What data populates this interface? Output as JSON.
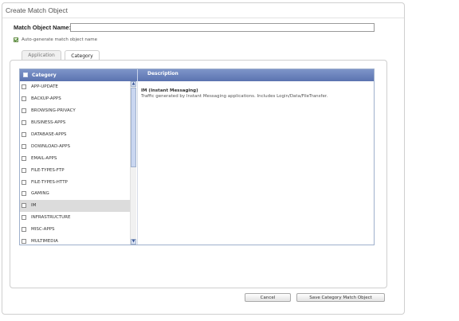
{
  "dialog": {
    "title": "Create Match Object",
    "match_object_name_label": "Match Object Name:",
    "match_object_name_value": "",
    "auto_generate_label": "Auto-generate match object name",
    "auto_generate_checked": true
  },
  "tabs": [
    {
      "label": "Application",
      "active": false
    },
    {
      "label": "Category",
      "active": true
    }
  ],
  "grid": {
    "headers": {
      "category": "Category",
      "description": "Description"
    },
    "categories": [
      {
        "name": "APP-UPDATE",
        "selected": false
      },
      {
        "name": "BACKUP-APPS",
        "selected": false
      },
      {
        "name": "BROWSING-PRIVACY",
        "selected": false
      },
      {
        "name": "BUSINESS-APPS",
        "selected": false
      },
      {
        "name": "DATABASE-APPS",
        "selected": false
      },
      {
        "name": "DOWNLOAD-APPS",
        "selected": false
      },
      {
        "name": "EMAIL-APPS",
        "selected": false
      },
      {
        "name": "FILE-TYPES-FTP",
        "selected": false
      },
      {
        "name": "FILE-TYPES-HTTP",
        "selected": false
      },
      {
        "name": "GAMING",
        "selected": false
      },
      {
        "name": "IM",
        "selected": true
      },
      {
        "name": "INFRASTRUCTURE",
        "selected": false
      },
      {
        "name": "MISC-APPS",
        "selected": false
      },
      {
        "name": "MULTIMEDIA",
        "selected": false
      }
    ],
    "description_title": "IM (Instant Messaging)",
    "description_text": "Traffic generated by Instant Messaging applications. Includes Login/Data/FileTransfer."
  },
  "buttons": {
    "cancel": "Cancel",
    "save": "Save Category Match Object"
  },
  "colors": {
    "header_bg": "#6a82bf",
    "selected_row": "#dcdcdc",
    "checkbox_check": "#3b7a1f"
  }
}
